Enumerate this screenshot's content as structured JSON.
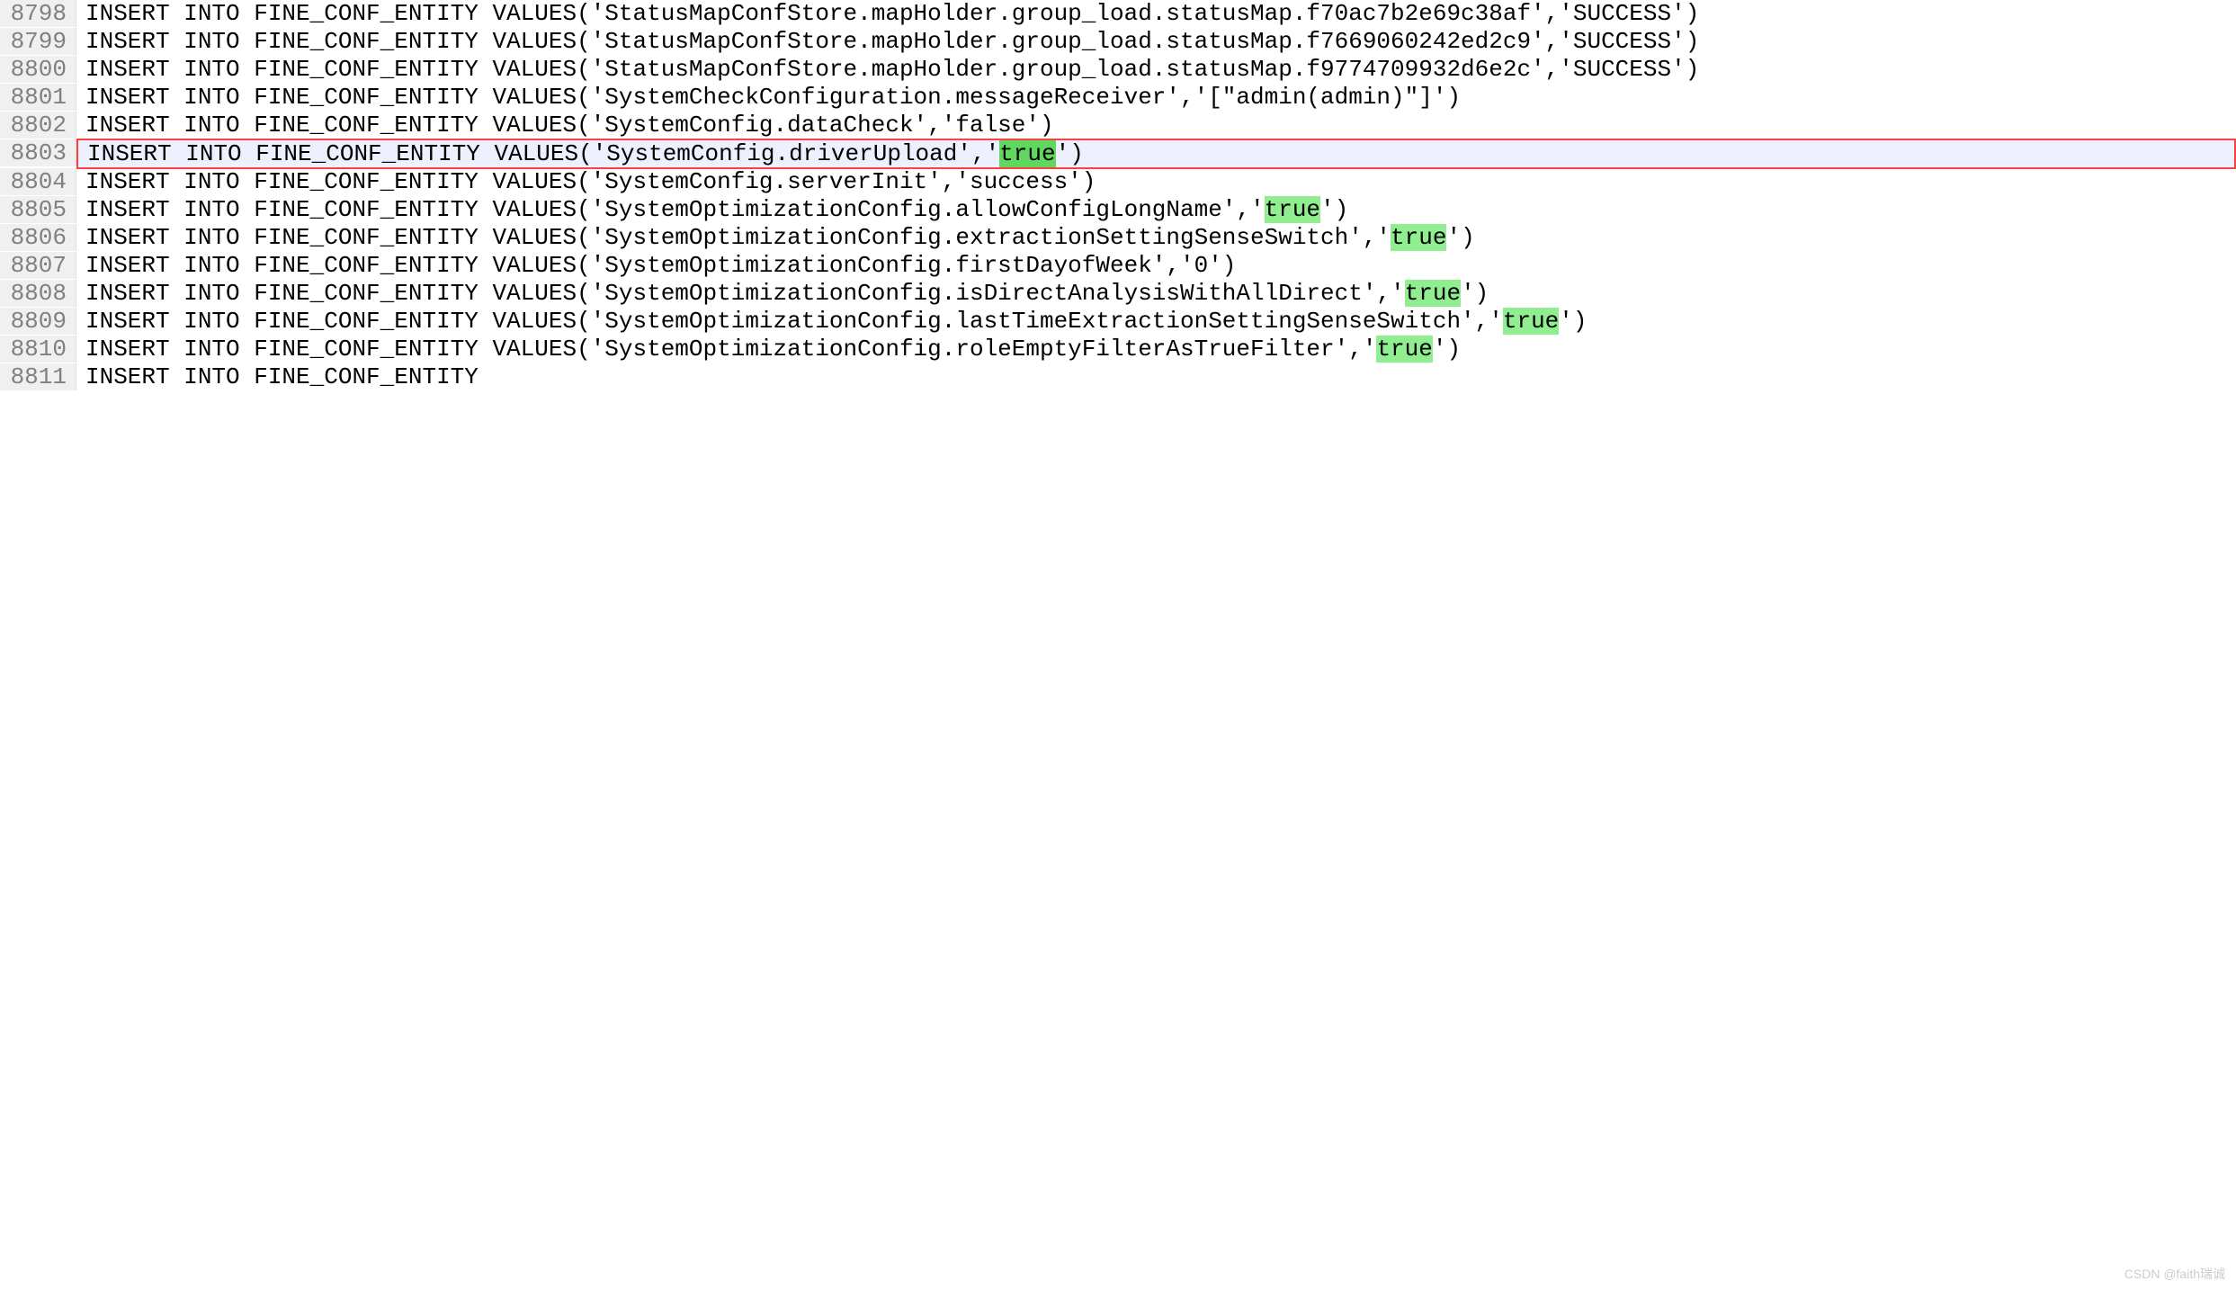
{
  "lines": [
    {
      "num": "8798",
      "text": "INSERT INTO FINE_CONF_ENTITY VALUES('StatusMapConfStore.mapHolder.group_load.statusMap.f70ac7b2e69c38af','SUCCESS')",
      "highlighted": false,
      "trueHighlights": []
    },
    {
      "num": "8799",
      "text": "INSERT INTO FINE_CONF_ENTITY VALUES('StatusMapConfStore.mapHolder.group_load.statusMap.f7669060242ed2c9','SUCCESS')",
      "highlighted": false,
      "trueHighlights": []
    },
    {
      "num": "8800",
      "text": "INSERT INTO FINE_CONF_ENTITY VALUES('StatusMapConfStore.mapHolder.group_load.statusMap.f9774709932d6e2c','SUCCESS')",
      "highlighted": false,
      "trueHighlights": []
    },
    {
      "num": "8801",
      "text": "INSERT INTO FINE_CONF_ENTITY VALUES('SystemCheckConfiguration.messageReceiver','[\"admin(admin)\"]')",
      "highlighted": false,
      "trueHighlights": []
    },
    {
      "num": "8802",
      "text": "INSERT INTO FINE_CONF_ENTITY VALUES('SystemConfig.dataCheck','false')",
      "highlighted": false,
      "trueHighlights": []
    },
    {
      "num": "8803",
      "text": "INSERT INTO FINE_CONF_ENTITY VALUES('SystemConfig.driverUpload','true')",
      "highlighted": true,
      "trueHighlights": [
        "true-selected"
      ]
    },
    {
      "num": "8804",
      "text": "INSERT INTO FINE_CONF_ENTITY VALUES('SystemConfig.serverInit','success')",
      "highlighted": false,
      "trueHighlights": []
    },
    {
      "num": "8805",
      "text": "INSERT INTO FINE_CONF_ENTITY VALUES('SystemOptimizationConfig.allowConfigLongName','true')",
      "highlighted": false,
      "trueHighlights": [
        "true"
      ]
    },
    {
      "num": "8806",
      "text": "INSERT INTO FINE_CONF_ENTITY VALUES('SystemOptimizationConfig.extractionSettingSenseSwitch','true')",
      "highlighted": false,
      "trueHighlights": [
        "true"
      ]
    },
    {
      "num": "8807",
      "text": "INSERT INTO FINE_CONF_ENTITY VALUES('SystemOptimizationConfig.firstDayofWeek','0')",
      "highlighted": false,
      "trueHighlights": []
    },
    {
      "num": "8808",
      "text": "INSERT INTO FINE_CONF_ENTITY VALUES('SystemOptimizationConfig.isDirectAnalysisWithAllDirect','true')",
      "highlighted": false,
      "trueHighlights": [
        "true"
      ]
    },
    {
      "num": "8809",
      "text": "INSERT INTO FINE_CONF_ENTITY VALUES('SystemOptimizationConfig.lastTimeExtractionSettingSenseSwitch','true')",
      "highlighted": false,
      "trueHighlights": [
        "true"
      ]
    },
    {
      "num": "8810",
      "text": "INSERT INTO FINE_CONF_ENTITY VALUES('SystemOptimizationConfig.roleEmptyFilterAsTrueFilter','true')",
      "highlighted": false,
      "trueHighlights": [
        "true"
      ]
    },
    {
      "num": "8811",
      "text": "INSERT INTO FINE_CONF_ENTITY",
      "highlighted": false,
      "trueHighlights": [],
      "partial": true
    }
  ],
  "watermark": "CSDN @faith瑞诚"
}
